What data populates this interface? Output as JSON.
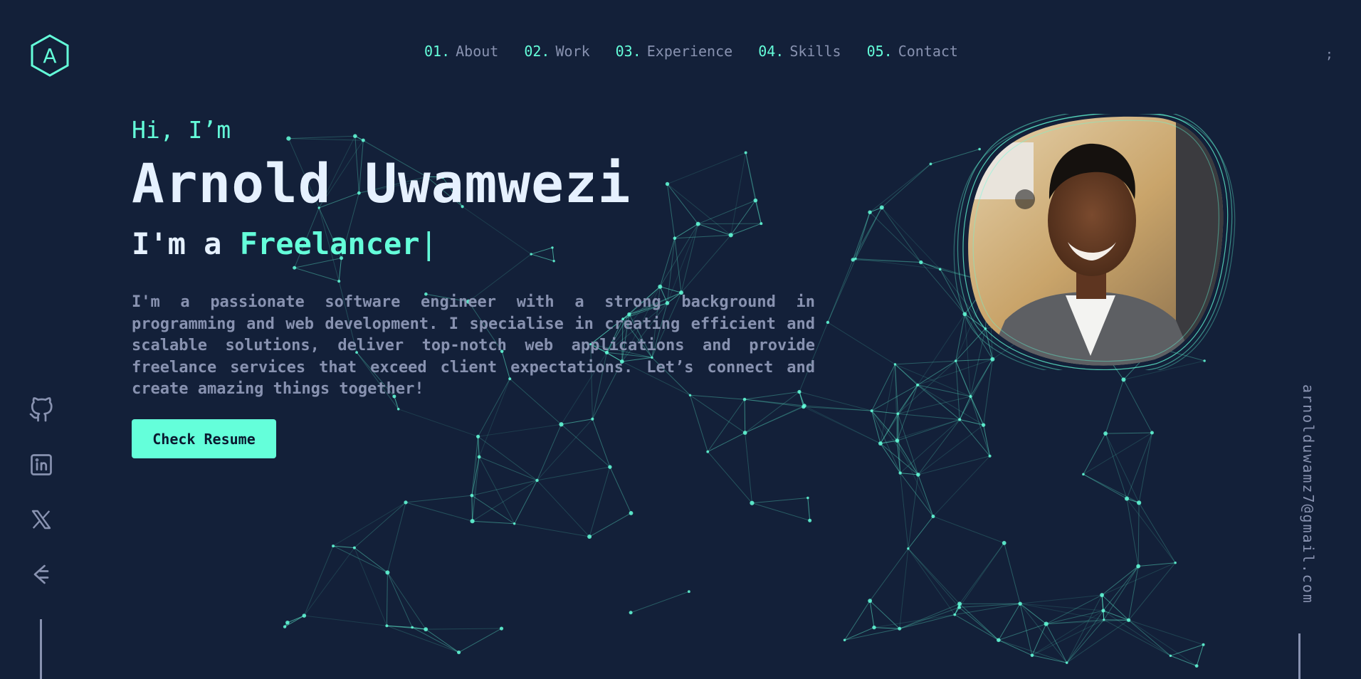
{
  "brand": {
    "logo_letter": "A"
  },
  "nav": {
    "items": [
      {
        "num": "01.",
        "label": "About"
      },
      {
        "num": "02.",
        "label": "Work"
      },
      {
        "num": "03.",
        "label": "Experience"
      },
      {
        "num": "04.",
        "label": "Skills"
      },
      {
        "num": "05.",
        "label": "Contact"
      }
    ],
    "stray": ";"
  },
  "hero": {
    "greeting": "Hi, I’m",
    "name": "Arnold Uwamwezi",
    "role_prefix": "I'm a ",
    "role_highlight": "Freelancer",
    "caret": "|",
    "bio": "I'm a passionate software engineer with a strong background in programming and web development. I specialise in creating efficient and scalable solutions, deliver top-notch web applications and provide freelance services that exceed client expectations. Let’s connect and create amazing things together!",
    "cta_label": "Check Resume"
  },
  "socials": [
    {
      "name": "github-icon"
    },
    {
      "name": "linkedin-icon"
    },
    {
      "name": "x-icon"
    },
    {
      "name": "codepen-icon"
    }
  ],
  "email": "arnolduwamz7@gmail.com",
  "colors": {
    "background": "#132039",
    "accent": "#64ffda",
    "text_primary": "#e6f1ff",
    "text_secondary": "#8892b0"
  }
}
